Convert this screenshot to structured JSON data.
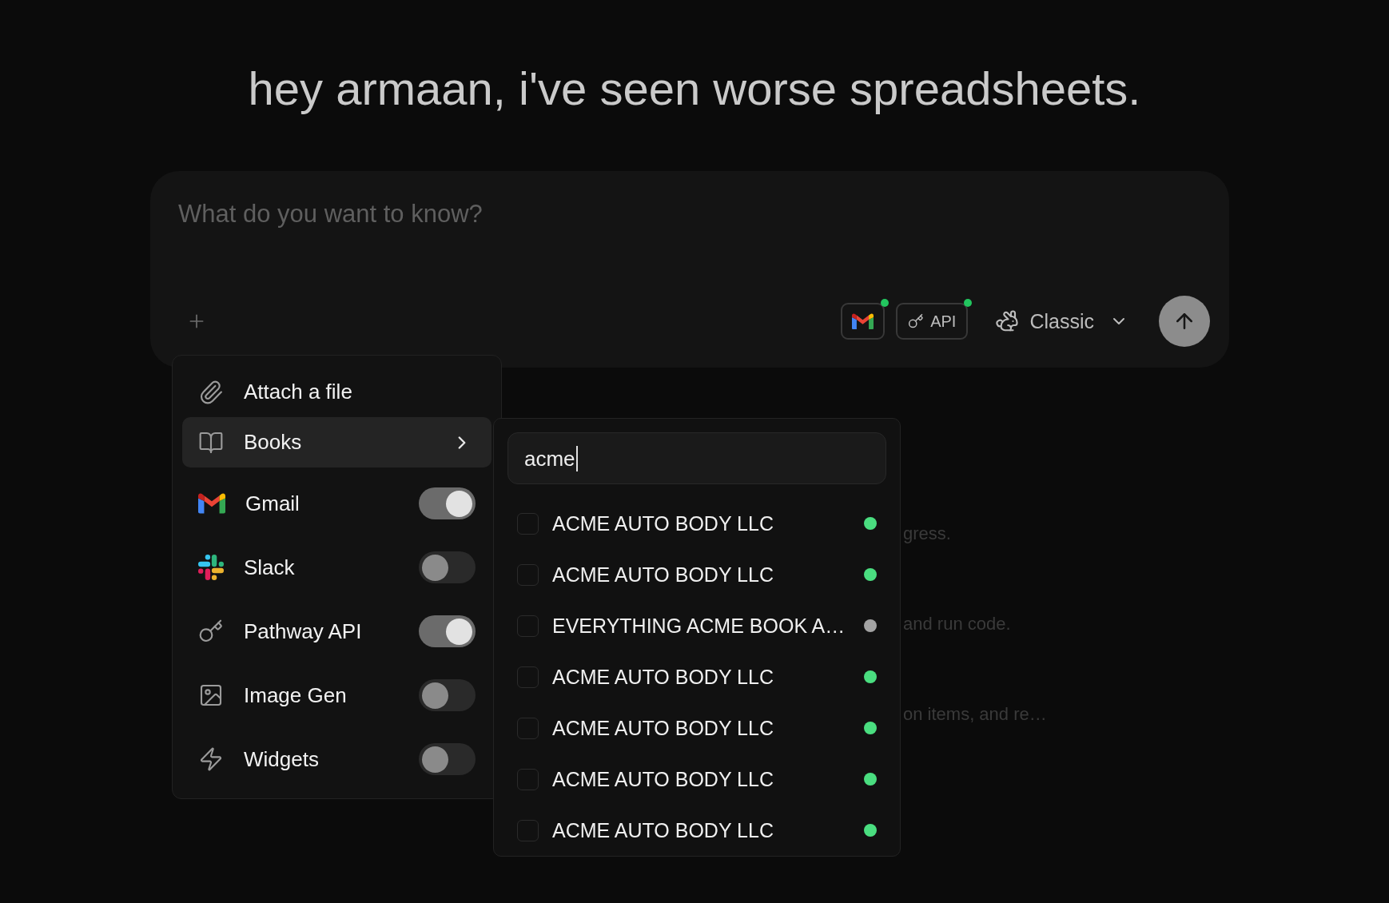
{
  "greeting": "hey armaan, i've seen worse spreadsheets.",
  "composer": {
    "placeholder": "What do you want to know?",
    "connectors": [
      {
        "kind": "gmail",
        "connected": true
      },
      {
        "kind": "api",
        "label": "API",
        "connected": true
      }
    ],
    "model": {
      "label": "Classic"
    }
  },
  "attach_menu": {
    "items": [
      {
        "kind": "action",
        "label": "Attach a file",
        "selected": false
      },
      {
        "kind": "submenu",
        "label": "Books",
        "selected": true
      },
      {
        "kind": "toggle",
        "label": "Gmail",
        "on": true,
        "selected": false
      },
      {
        "kind": "toggle",
        "label": "Slack",
        "on": false,
        "selected": false
      },
      {
        "kind": "toggle",
        "label": "Pathway API",
        "on": true,
        "selected": false
      },
      {
        "kind": "toggle",
        "label": "Image Gen",
        "on": false,
        "selected": false
      },
      {
        "kind": "toggle",
        "label": "Widgets",
        "on": false,
        "selected": false
      }
    ]
  },
  "books_submenu": {
    "search": {
      "value": "acme"
    },
    "items": [
      {
        "label": "ACME AUTO BODY LLC",
        "checked": false,
        "color": "#4ade80"
      },
      {
        "label": "ACME AUTO BODY LLC",
        "checked": false,
        "color": "#4ade80"
      },
      {
        "label": "EVERYTHING ACME BOOK A…",
        "checked": false,
        "color": "#a3a3a3"
      },
      {
        "label": "ACME AUTO BODY LLC",
        "checked": false,
        "color": "#4ade80"
      },
      {
        "label": "ACME AUTO BODY LLC",
        "checked": false,
        "color": "#4ade80"
      },
      {
        "label": "ACME AUTO BODY LLC",
        "checked": false,
        "color": "#4ade80"
      },
      {
        "label": "ACME AUTO BODY LLC",
        "checked": false,
        "color": "#4ade80"
      }
    ]
  },
  "background_suggestions": [
    "gress.",
    "and run code.",
    "on items, and re…"
  ]
}
